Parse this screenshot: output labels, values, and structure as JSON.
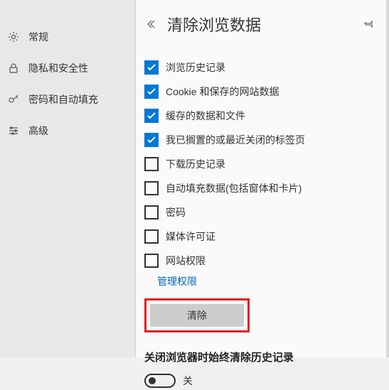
{
  "sidebar": {
    "items": [
      {
        "label": "常规"
      },
      {
        "label": "隐私和安全性"
      },
      {
        "label": "密码和自动填充"
      },
      {
        "label": "高级"
      }
    ]
  },
  "header": {
    "title": "清除浏览数据"
  },
  "options": [
    {
      "label": "浏览历史记录",
      "checked": true
    },
    {
      "label": "Cookie 和保存的网站数据",
      "checked": true
    },
    {
      "label": "缓存的数据和文件",
      "checked": true
    },
    {
      "label": "我已搁置的或最近关闭的标签页",
      "checked": true
    },
    {
      "label": "下载历史记录",
      "checked": false
    },
    {
      "label": "自动填充数据(包括窗体和卡片)",
      "checked": false
    },
    {
      "label": "密码",
      "checked": false
    },
    {
      "label": "媒体许可证",
      "checked": false
    },
    {
      "label": "网站权限",
      "checked": false
    }
  ],
  "managePermissionsLink": "管理权限",
  "clearButton": "清除",
  "autoCloseSection": {
    "title": "关闭浏览器时始终清除历史记录",
    "toggleLabel": "关"
  }
}
